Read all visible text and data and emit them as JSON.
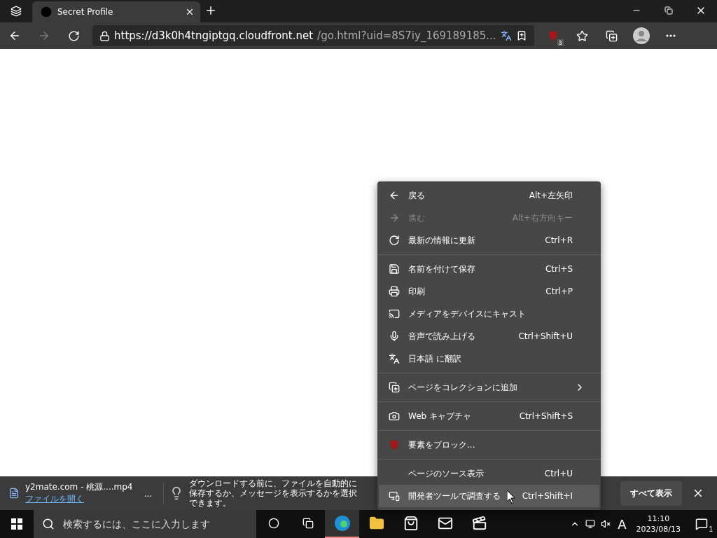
{
  "tab": {
    "title": "Secret Profile",
    "selected": true
  },
  "address_bar": {
    "url_host": "https://d3k0h4tngiptgq.cloudfront.net",
    "url_path": "/go.html?uid=8S7iy_169189185...",
    "back_disabled": false,
    "forward_disabled": true
  },
  "extension_badge": "3",
  "context_menu": {
    "groups": [
      [
        {
          "label": "戻る",
          "shortcut": "Alt+左矢印",
          "disabled": false,
          "highlighted": false
        },
        {
          "label": "進む",
          "shortcut": "Alt+右方向キー",
          "disabled": true,
          "highlighted": false
        },
        {
          "label": "最新の情報に更新",
          "shortcut": "Ctrl+R",
          "disabled": false,
          "highlighted": false
        }
      ],
      [
        {
          "label": "名前を付けて保存",
          "shortcut": "Ctrl+S",
          "disabled": false,
          "highlighted": false
        },
        {
          "label": "印刷",
          "shortcut": "Ctrl+P",
          "disabled": false,
          "highlighted": false
        },
        {
          "label": "メディアをデバイスにキャスト",
          "disabled": false,
          "highlighted": false
        },
        {
          "label": "音声で読み上げる",
          "shortcut": "Ctrl+Shift+U",
          "disabled": false,
          "highlighted": false
        },
        {
          "label": "日本語 に翻訳",
          "disabled": false,
          "highlighted": false
        }
      ],
      [
        {
          "label": "ページをコレクションに追加",
          "submenu": true,
          "disabled": false,
          "highlighted": false
        }
      ],
      [
        {
          "label": "Web キャプチャ",
          "shortcut": "Ctrl+Shift+S",
          "disabled": false,
          "highlighted": false
        }
      ],
      [
        {
          "label": "要素をブロック...",
          "disabled": false,
          "highlighted": false
        }
      ],
      [
        {
          "label": "ページのソース表示",
          "shortcut": "Ctrl+U",
          "disabled": false,
          "highlighted": false
        },
        {
          "label": "開発者ツールで調査する",
          "shortcut": "Ctrl+Shift+I",
          "disabled": false,
          "highlighted": true
        }
      ]
    ]
  },
  "download_bar": {
    "file_name": "y2mate.com - 桃源....mp4",
    "open_link": "ファイルを開く",
    "more": "...",
    "message": "ダウンロードする前に、ファイルを自動的に保存するか、メッセージを表示するかを選択できます。",
    "show_all": "すべて表示"
  },
  "taskbar": {
    "search_placeholder": "検索するには、ここに入力します",
    "ime": "A",
    "time": "11:10",
    "date": "2023/08/13",
    "notifications": "1"
  }
}
